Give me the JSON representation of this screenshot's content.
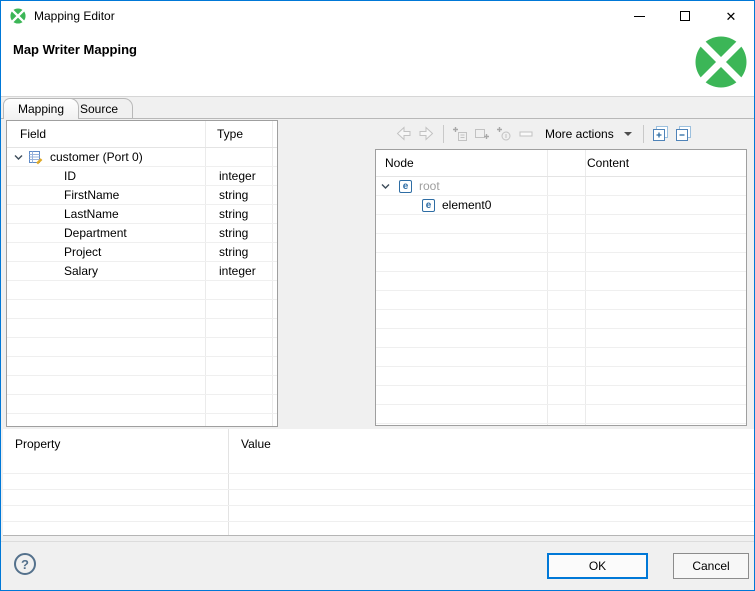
{
  "window": {
    "title": "Mapping Editor",
    "close_glyph": "✕"
  },
  "header": {
    "title": "Map Writer Mapping"
  },
  "tabs": {
    "mapping": "Mapping",
    "source": "Source"
  },
  "field_table": {
    "col_field": "Field",
    "col_type": "Type",
    "root_label": "customer (Port 0)",
    "rows": [
      {
        "field": "ID",
        "type": "integer"
      },
      {
        "field": "FirstName",
        "type": "string"
      },
      {
        "field": "LastName",
        "type": "string"
      },
      {
        "field": "Department",
        "type": "string"
      },
      {
        "field": "Project",
        "type": "string"
      },
      {
        "field": "Salary",
        "type": "integer"
      }
    ]
  },
  "toolbar": {
    "more_actions": "More actions"
  },
  "node_table": {
    "col_node": "Node",
    "col_content": "Content",
    "element_glyph": "e",
    "root_label": "root",
    "child_label": "element0"
  },
  "property_table": {
    "col_property": "Property",
    "col_value": "Value"
  },
  "footer": {
    "help_glyph": "?",
    "ok": "OK",
    "cancel": "Cancel"
  },
  "colors": {
    "accent": "#0078d7",
    "clover_green": "#3cb657",
    "tree_blue": "#2e6da4",
    "disabled_icon": "#c2c2c2",
    "muted_text": "#9e9e9e"
  }
}
